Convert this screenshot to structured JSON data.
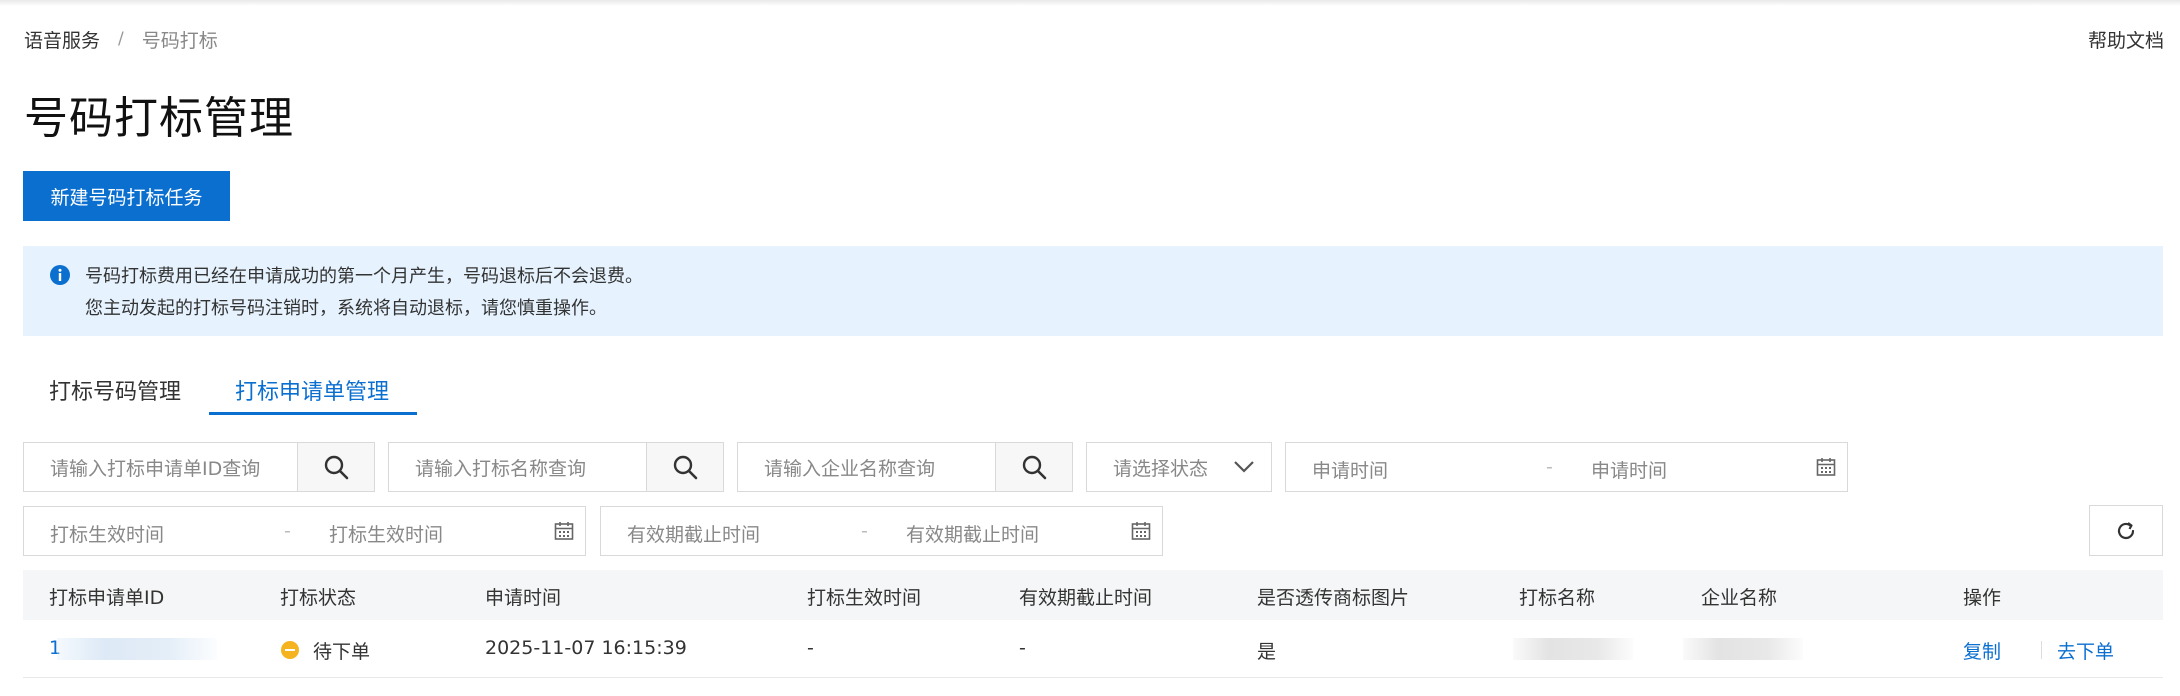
{
  "breadcrumb": {
    "root": "语音服务",
    "separator": "/",
    "current": "号码打标"
  },
  "help_link": "帮助文档",
  "page_title": "号码打标管理",
  "primary_button": "新建号码打标任务",
  "alert": {
    "line1": "号码打标费用已经在申请成功的第一个月产生，号码退标后不会退费。",
    "line2": "您主动发起的打标号码注销时，系统将自动退标，请您慎重操作。"
  },
  "tabs": [
    {
      "label": "打标号码管理",
      "active": false
    },
    {
      "label": "打标申请单管理",
      "active": true
    }
  ],
  "filters": {
    "search_request_id": "请输入打标申请单ID查询",
    "search_mark_name": "请输入打标名称查询",
    "search_company": "请输入企业名称查询",
    "status_select": "请选择状态",
    "apply_time_start": "申请时间",
    "apply_time_end": "申请时间",
    "effective_start": "打标生效时间",
    "effective_end": "打标生效时间",
    "expire_start": "有效期截止时间",
    "expire_end": "有效期截止时间",
    "range_dash": "-"
  },
  "table": {
    "headers": [
      "打标申请单ID",
      "打标状态",
      "申请时间",
      "打标生效时间",
      "有效期截止时间",
      "是否透传商标图片",
      "打标名称",
      "企业名称",
      "操作"
    ],
    "rows": [
      {
        "id": "1",
        "status": "待下单",
        "apply_time": "2025-11-07 16:15:39",
        "effective_time": "-",
        "expire_time": "-",
        "trademark": "是",
        "actions": [
          "复制",
          "去下单"
        ]
      }
    ]
  },
  "colors": {
    "primary": "#0b6fd0",
    "alert_bg": "#e6f3fe",
    "pending": "#f5b320"
  }
}
